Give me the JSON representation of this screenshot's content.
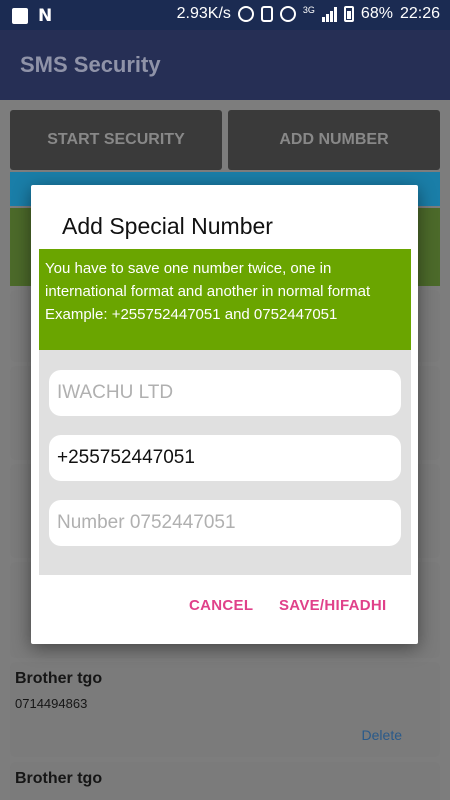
{
  "status_bar": {
    "speed": "2.93K/s",
    "network": "3G",
    "battery": "68%",
    "time": "22:26"
  },
  "app_bar": {
    "title": "SMS Security"
  },
  "background": {
    "start_button": "START SECURITY",
    "add_button": "ADD NUMBER",
    "cards": [
      {
        "name": "Brother tgo",
        "phone": "0714494863",
        "delete": "Delete"
      },
      {
        "name": "Brother tgo"
      }
    ]
  },
  "dialog": {
    "title": "Add Special Number",
    "notice": "You have to save one number twice, one in international format and another in normal format Example: +255752447051 and 0752447051",
    "name_field": {
      "value": "",
      "placeholder": "IWACHU LTD"
    },
    "intl_field": {
      "value": "+255752447051",
      "placeholder": ""
    },
    "normal_field": {
      "value": "",
      "placeholder": "Number 0752447051"
    },
    "cancel_label": "CANCEL",
    "save_label": "SAVE/HIFADHI"
  }
}
